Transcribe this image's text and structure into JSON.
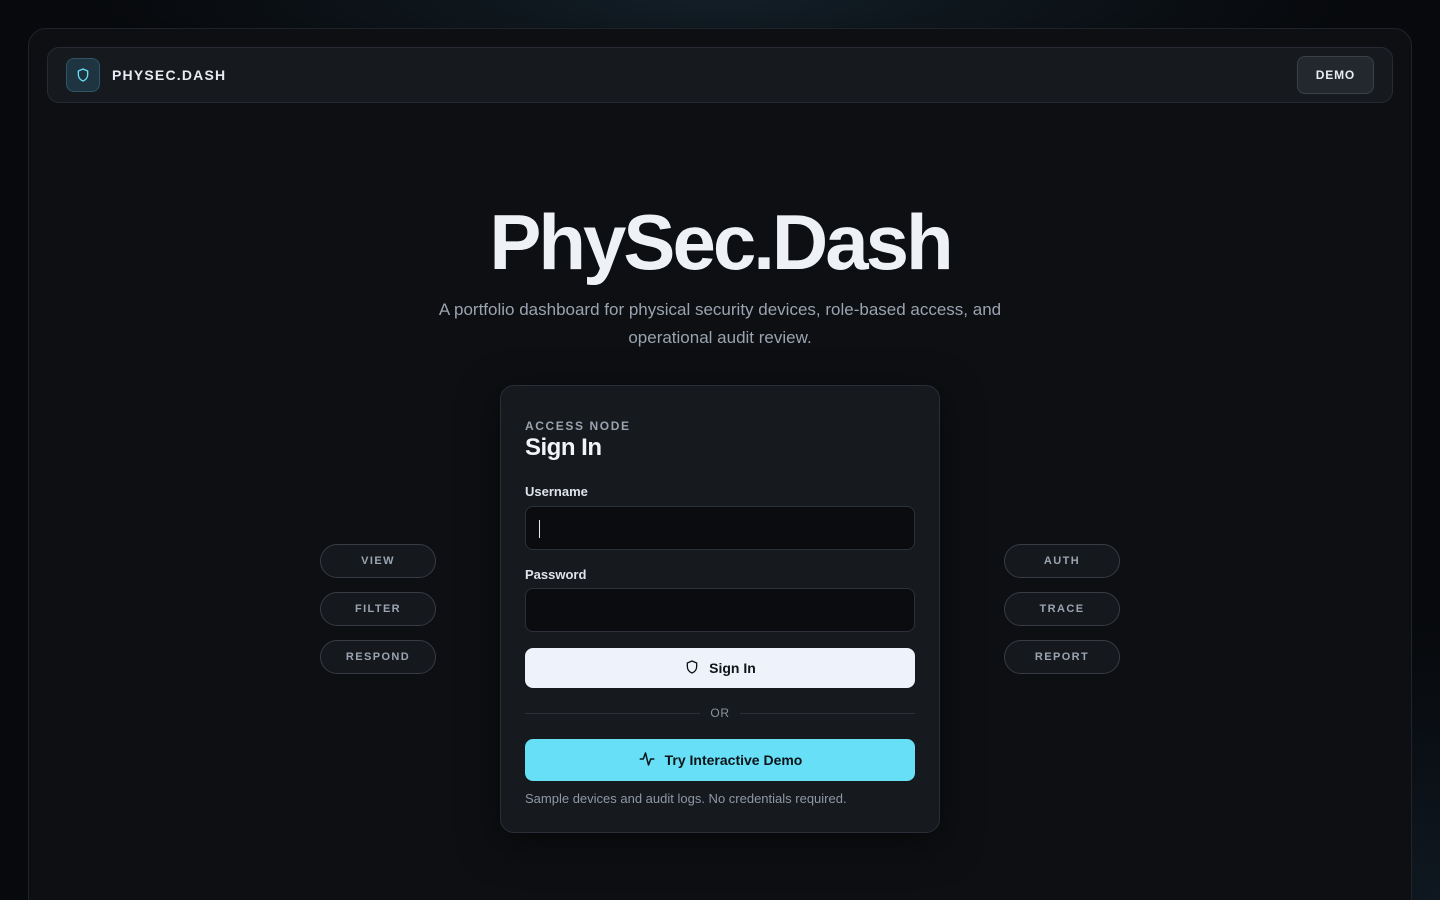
{
  "brand": {
    "name": "PHYSEC.DASH",
    "icon": "shield-icon"
  },
  "header": {
    "demo_label": "DEMO"
  },
  "hero": {
    "title": "PhySec.Dash",
    "subtitle": "A portfolio dashboard for physical security devices, role-based access, and operational audit review."
  },
  "login": {
    "kicker": "ACCESS NODE",
    "title": "Sign In",
    "username_label": "Username",
    "username_value": "",
    "password_label": "Password",
    "password_value": "",
    "signin_label": "Sign In",
    "divider_label": "OR",
    "demo_cta_label": "Try Interactive Demo",
    "hint": "Sample devices and audit logs. No credentials required."
  },
  "left_pills": [
    "VIEW",
    "FILTER",
    "RESPOND"
  ],
  "right_pills": [
    "AUTH",
    "TRACE",
    "REPORT"
  ],
  "colors": {
    "accent": "#67dff7",
    "background": "#0d0f12",
    "card": "#16191e",
    "signin_button": "#eef2fa"
  }
}
